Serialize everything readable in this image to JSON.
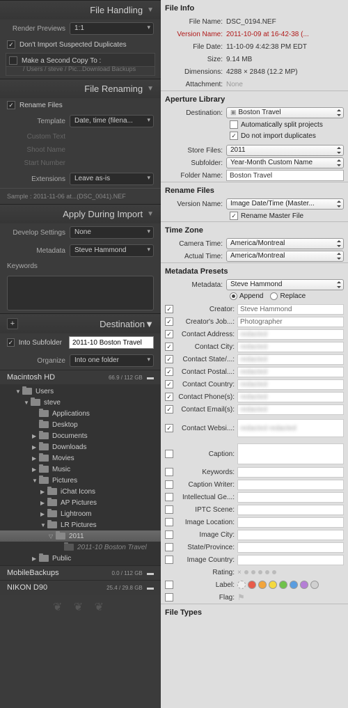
{
  "left": {
    "fileHandling": {
      "title": "File Handling",
      "renderPreviewsLabel": "Render Previews",
      "renderPreviewsValue": "1:1",
      "noDupes": "Don't Import Suspected Duplicates",
      "secondCopy": "Make a Second Copy To :",
      "secondCopyPath": "/ Users / steve / Pic...Download Backups"
    },
    "fileRenaming": {
      "title": "File Renaming",
      "rename": "Rename Files",
      "templateLabel": "Template",
      "templateValue": "Date, time (filena...",
      "customText": "Custom Text",
      "shootName": "Shoot Name",
      "startNumber": "Start Number",
      "extLabel": "Extensions",
      "extValue": "Leave as-is",
      "sample": "Sample :  2011-11-06 at...(DSC_0041).NEF"
    },
    "apply": {
      "title": "Apply During Import",
      "devLabel": "Develop Settings",
      "devValue": "None",
      "metaLabel": "Metadata",
      "metaValue": "Steve Hammond",
      "keywordsLabel": "Keywords"
    },
    "destination": {
      "title": "Destination",
      "intoSub": "Into Subfolder",
      "intoSubVal": "2011-10 Boston Travel",
      "orgLabel": "Organize",
      "orgVal": "Into one folder",
      "vol1": "Macintosh HD",
      "vol1cap": "66.9 / 112 GB",
      "tree": {
        "users": "Users",
        "steve": "steve",
        "apps": "Applications",
        "desktop": "Desktop",
        "docs": "Documents",
        "dl": "Downloads",
        "movies": "Movies",
        "music": "Music",
        "pics": "Pictures",
        "ichat": "iChat Icons",
        "appics": "AP Pictures",
        "lr": "Lightroom",
        "lrpics": "LR Pictures",
        "y2011": "2011",
        "newf": "2011-10 Boston Travel",
        "public": "Public"
      },
      "vol2": "MobileBackups",
      "vol2cap": "0.0 / 112 GB",
      "vol3": "NIKON D90",
      "vol3cap": "25.4 / 29.8 GB"
    }
  },
  "right": {
    "fileInfo": {
      "title": "File Info",
      "fileNameL": "File Name:",
      "fileName": "DSC_0194.NEF",
      "verNameL": "Version Name:",
      "verName": "2011-10-09 at 16-42-38 (...",
      "fileDateL": "File Date:",
      "fileDate": "11-10-09 4:42:38 PM EDT",
      "sizeL": "Size:",
      "size": "9.14 MB",
      "dimL": "Dimensions:",
      "dim": "4288 × 2848 (12.2 MP)",
      "attL": "Attachment:",
      "att": "None"
    },
    "apLib": {
      "title": "Aperture Library",
      "destL": "Destination:",
      "dest": "Boston Travel",
      "autoSplit": "Automatically split projects",
      "noDupes": "Do not import duplicates",
      "storeL": "Store Files:",
      "store": "2011",
      "subfL": "Subfolder:",
      "subf": "Year-Month Custom Name",
      "foldL": "Folder Name:",
      "fold": "Boston Travel"
    },
    "rename": {
      "title": "Rename Files",
      "verL": "Version Name:",
      "ver": "Image Date/Time (Master...",
      "renameMaster": "Rename Master File"
    },
    "tz": {
      "title": "Time Zone",
      "camL": "Camera Time:",
      "cam": "America/Montreal",
      "actL": "Actual Time:",
      "act": "America/Montreal"
    },
    "meta": {
      "title": "Metadata Presets",
      "metaL": "Metadata:",
      "metaV": "Steve Hammond",
      "append": "Append",
      "replace": "Replace",
      "fields": [
        {
          "label": "Creator:",
          "val": "Steve Hammond",
          "chk": true,
          "blur": false
        },
        {
          "label": "Creator's Job...:",
          "val": "Photographer",
          "chk": true,
          "blur": false
        },
        {
          "label": "Contact Address:",
          "val": "redacted",
          "chk": true,
          "blur": true
        },
        {
          "label": "Contact City:",
          "val": "redacted",
          "chk": true,
          "blur": true
        },
        {
          "label": "Contact State/...:",
          "val": "redacted",
          "chk": true,
          "blur": true
        },
        {
          "label": "Contact Postal...:",
          "val": "redacted",
          "chk": true,
          "blur": true
        },
        {
          "label": "Contact Country:",
          "val": "redacted",
          "chk": true,
          "blur": true
        },
        {
          "label": "Contact Phone(s):",
          "val": "redacted",
          "chk": true,
          "blur": true
        },
        {
          "label": "Contact Email(s):",
          "val": "redacted",
          "chk": true,
          "blur": true
        }
      ],
      "websiteL": "Contact Websi...:",
      "emptyFields": [
        {
          "label": "Caption:",
          "textarea": true
        },
        {
          "label": "Keywords:"
        },
        {
          "label": "Caption Writer:"
        },
        {
          "label": "Intellectual Ge...:"
        },
        {
          "label": "IPTC Scene:"
        },
        {
          "label": "Image Location:"
        },
        {
          "label": "Image City:"
        },
        {
          "label": "State/Province:"
        },
        {
          "label": "Image Country:"
        }
      ],
      "ratingL": "Rating:",
      "labelL": "Label:",
      "labelColors": [
        "#eee",
        "#e85b4a",
        "#f2a53c",
        "#f4d93f",
        "#6fc24a",
        "#5a9de0",
        "#b57ed6",
        "#d0d0d0"
      ],
      "flagL": "Flag:"
    },
    "fileTypes": {
      "title": "File Types"
    }
  }
}
